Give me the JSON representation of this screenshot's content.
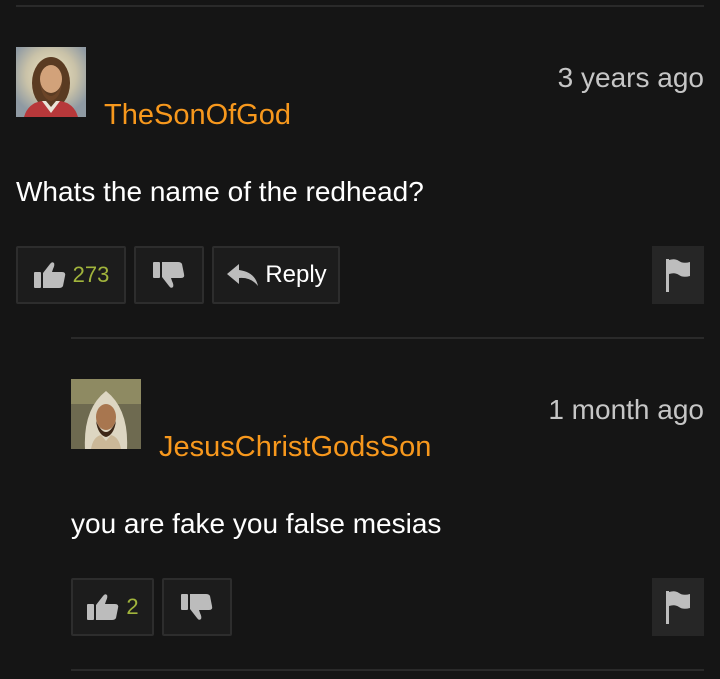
{
  "comments": [
    {
      "username": "TheSonOfGod",
      "time": "3 years ago",
      "text": "Whats the name of the redhead?",
      "likes": "273",
      "reply_label": "Reply"
    },
    {
      "username": "JesusChristGodsSon",
      "time": "1 month ago",
      "text": "you are fake you false mesias",
      "likes": "2"
    }
  ],
  "icons": {
    "like": "thumbs-up-icon",
    "dislike": "thumbs-down-icon",
    "reply": "reply-arrow-icon",
    "flag": "flag-icon"
  },
  "colors": {
    "background": "#151515",
    "username": "#f7981d",
    "like_count": "#a1b43c",
    "timestamp": "#c6c6c6"
  }
}
